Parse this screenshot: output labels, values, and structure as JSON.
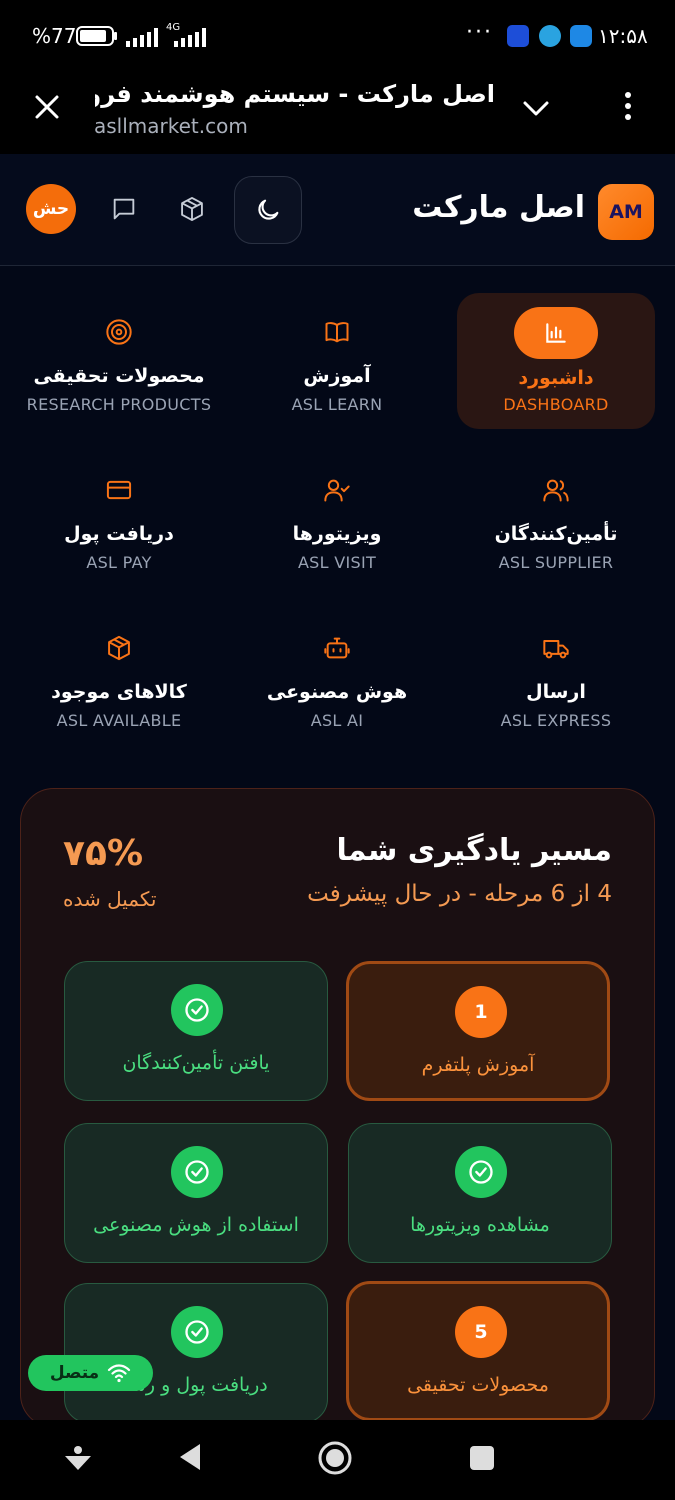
{
  "status_bar": {
    "battery": "%77",
    "network": "4G",
    "time": "۱۲:۵۸",
    "dots": "···"
  },
  "browser": {
    "page_title": "اصل مارکت - سیستم هوشمند فروش",
    "url": "asllmarket.com"
  },
  "header": {
    "logo_text": "AM",
    "app_title": "اصل مارکت",
    "avatar_text": "حش"
  },
  "menu": [
    {
      "id": "dashboard",
      "fa": "داشبورد",
      "en": "DASHBOARD",
      "icon": "bar-chart-icon",
      "active": true
    },
    {
      "id": "learn",
      "fa": "آموزش",
      "en": "ASL LEARN",
      "icon": "book-icon"
    },
    {
      "id": "research",
      "fa": "محصولات تحقیقی",
      "en": "RESEARCH PRODUCTS",
      "icon": "target-icon"
    },
    {
      "id": "supplier",
      "fa": "تأمین‌کنندگان",
      "en": "ASL SUPPLIER",
      "icon": "users-icon"
    },
    {
      "id": "visit",
      "fa": "ویزیتورها",
      "en": "ASL VISIT",
      "icon": "user-check-icon"
    },
    {
      "id": "pay",
      "fa": "دریافت پول",
      "en": "ASL PAY",
      "icon": "credit-card-icon"
    },
    {
      "id": "express",
      "fa": "ارسال",
      "en": "ASL EXPRESS",
      "icon": "truck-icon"
    },
    {
      "id": "ai",
      "fa": "هوش مصنوعی",
      "en": "ASL AI",
      "icon": "bot-icon"
    },
    {
      "id": "available",
      "fa": "کالاهای موجود",
      "en": "ASL AVAILABLE",
      "icon": "package-icon"
    }
  ],
  "learning": {
    "title": "مسیر یادگیری شما",
    "subtitle": "4 از 6 مرحله - در حال پیشرفت",
    "percent": "۷۵%",
    "percent_label": "تکمیل شده",
    "progress_fraction": 0.75,
    "steps": [
      {
        "label": "آموزش پلتفرم",
        "status": "current",
        "number": "1"
      },
      {
        "label": "یافتن تأمین‌کنندگان",
        "status": "done"
      },
      {
        "label": "مشاهده ویزیتورها",
        "status": "done"
      },
      {
        "label": "استفاده از هوش مصنوعی",
        "status": "done"
      },
      {
        "label": "محصولات تحقیقی",
        "status": "current",
        "number": "5"
      },
      {
        "label": "دریافت پول و رسا",
        "status": "done"
      }
    ]
  },
  "connection": {
    "label": "متصل"
  },
  "colors": {
    "accent": "#f97316",
    "success": "#22c55e",
    "background": "#030817"
  }
}
